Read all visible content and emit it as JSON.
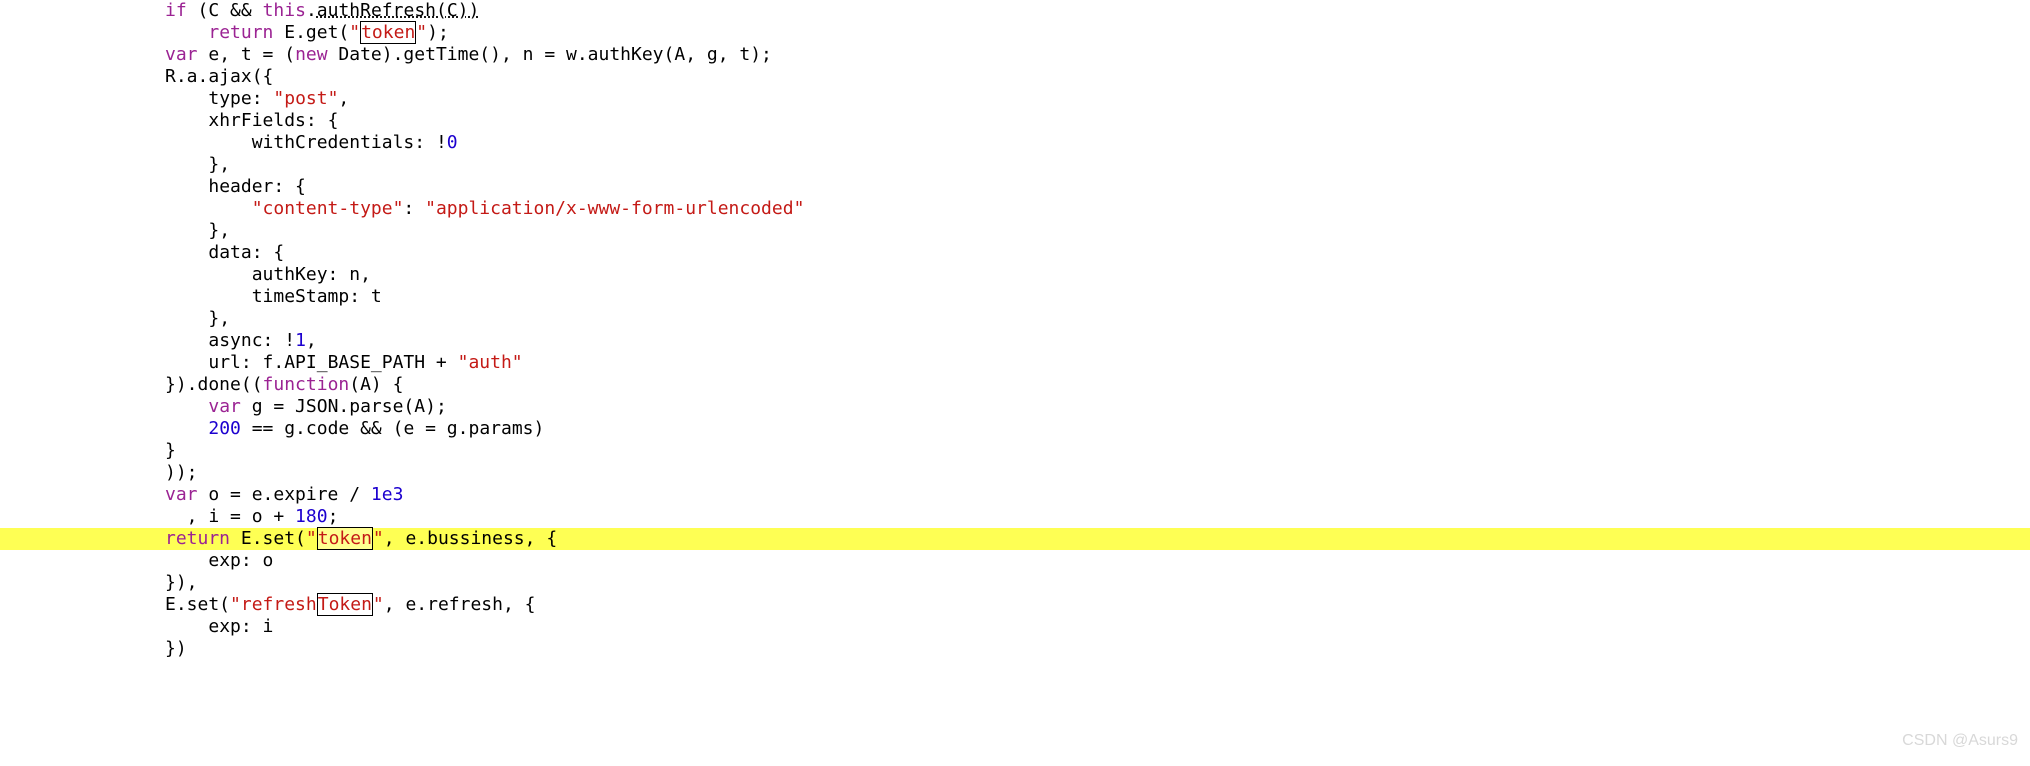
{
  "code": {
    "lines": [
      {
        "indent": 0,
        "hl": false,
        "parts": [
          {
            "c": "kw",
            "t": "if"
          },
          {
            "c": "op",
            "t": " (C "
          },
          {
            "c": "op",
            "t": "&&"
          },
          {
            "c": "op",
            "t": " "
          },
          {
            "c": "kw",
            "t": "this"
          },
          {
            "c": "op",
            "t": "."
          },
          {
            "c": "und",
            "t": "authRefresh(C))"
          }
        ]
      },
      {
        "indent": 1,
        "hl": false,
        "parts": [
          {
            "c": "kw",
            "t": "return"
          },
          {
            "c": "op",
            "t": " E.get("
          },
          {
            "c": "str",
            "t": "\""
          },
          {
            "c": "box",
            "t": "token"
          },
          {
            "c": "str",
            "t": "\""
          },
          {
            "c": "op",
            "t": ");"
          }
        ]
      },
      {
        "indent": 0,
        "hl": false,
        "parts": [
          {
            "c": "kw",
            "t": "var"
          },
          {
            "c": "op",
            "t": " e, t = ("
          },
          {
            "c": "kw",
            "t": "new"
          },
          {
            "c": "op",
            "t": " Date).getTime(), n = w.authKey(A, g, t);"
          }
        ]
      },
      {
        "indent": 0,
        "hl": false,
        "parts": [
          {
            "c": "op",
            "t": "R.a.ajax({"
          }
        ]
      },
      {
        "indent": 1,
        "hl": false,
        "parts": [
          {
            "c": "pname",
            "t": "type: "
          },
          {
            "c": "str",
            "t": "\"post\""
          },
          {
            "c": "op",
            "t": ","
          }
        ]
      },
      {
        "indent": 1,
        "hl": false,
        "parts": [
          {
            "c": "pname",
            "t": "xhrFields: {"
          }
        ]
      },
      {
        "indent": 2,
        "hl": false,
        "parts": [
          {
            "c": "pname",
            "t": "withCredentials: "
          },
          {
            "c": "op",
            "t": "!"
          },
          {
            "c": "num",
            "t": "0"
          }
        ]
      },
      {
        "indent": 1,
        "hl": false,
        "parts": [
          {
            "c": "op",
            "t": "},"
          }
        ]
      },
      {
        "indent": 1,
        "hl": false,
        "parts": [
          {
            "c": "pname",
            "t": "header: {"
          }
        ]
      },
      {
        "indent": 2,
        "hl": false,
        "parts": [
          {
            "c": "str",
            "t": "\"content-type\""
          },
          {
            "c": "op",
            "t": ": "
          },
          {
            "c": "str",
            "t": "\"application/x-www-form-urlencoded\""
          }
        ]
      },
      {
        "indent": 1,
        "hl": false,
        "parts": [
          {
            "c": "op",
            "t": "},"
          }
        ]
      },
      {
        "indent": 1,
        "hl": false,
        "parts": [
          {
            "c": "pname",
            "t": "data: {"
          }
        ]
      },
      {
        "indent": 2,
        "hl": false,
        "parts": [
          {
            "c": "pname",
            "t": "authKey: n,"
          }
        ]
      },
      {
        "indent": 2,
        "hl": false,
        "parts": [
          {
            "c": "pname",
            "t": "timeStamp: t"
          }
        ]
      },
      {
        "indent": 1,
        "hl": false,
        "parts": [
          {
            "c": "op",
            "t": "},"
          }
        ]
      },
      {
        "indent": 1,
        "hl": false,
        "parts": [
          {
            "c": "pname",
            "t": "async: "
          },
          {
            "c": "op",
            "t": "!"
          },
          {
            "c": "num",
            "t": "1"
          },
          {
            "c": "op",
            "t": ","
          }
        ]
      },
      {
        "indent": 1,
        "hl": false,
        "parts": [
          {
            "c": "pname",
            "t": "url: f.API_BASE_PATH + "
          },
          {
            "c": "str",
            "t": "\"auth\""
          }
        ]
      },
      {
        "indent": 0,
        "hl": false,
        "parts": [
          {
            "c": "op",
            "t": "}).done(("
          },
          {
            "c": "kw",
            "t": "function"
          },
          {
            "c": "op",
            "t": "(A) {"
          }
        ]
      },
      {
        "indent": 1,
        "hl": false,
        "parts": [
          {
            "c": "kw",
            "t": "var"
          },
          {
            "c": "op",
            "t": " g = JSON.parse(A);"
          }
        ]
      },
      {
        "indent": 1,
        "hl": false,
        "parts": [
          {
            "c": "num",
            "t": "200"
          },
          {
            "c": "op",
            "t": " == g.code "
          },
          {
            "c": "op",
            "t": "&&"
          },
          {
            "c": "op",
            "t": " (e = g.params)"
          }
        ]
      },
      {
        "indent": 0,
        "hl": false,
        "parts": [
          {
            "c": "op",
            "t": "}"
          }
        ]
      },
      {
        "indent": 0,
        "hl": false,
        "parts": [
          {
            "c": "op",
            "t": "));"
          }
        ]
      },
      {
        "indent": 0,
        "hl": false,
        "parts": [
          {
            "c": "kw",
            "t": "var"
          },
          {
            "c": "op",
            "t": " o = e.expire / "
          },
          {
            "c": "num",
            "t": "1e3"
          }
        ]
      },
      {
        "indent": 0,
        "hl": false,
        "parts": [
          {
            "c": "op",
            "t": "  , i = o + "
          },
          {
            "c": "num",
            "t": "180"
          },
          {
            "c": "op",
            "t": ";"
          }
        ]
      },
      {
        "indent": 0,
        "hl": true,
        "parts": [
          {
            "c": "kw",
            "t": "return"
          },
          {
            "c": "op",
            "t": " E.set("
          },
          {
            "c": "str",
            "t": "\""
          },
          {
            "c": "box-hl",
            "t": "token"
          },
          {
            "c": "str",
            "t": "\""
          },
          {
            "c": "op",
            "t": ", e.bussiness, {"
          }
        ]
      },
      {
        "indent": 1,
        "hl": false,
        "parts": [
          {
            "c": "pname",
            "t": "exp: o"
          }
        ]
      },
      {
        "indent": 0,
        "hl": false,
        "parts": [
          {
            "c": "op",
            "t": "}),"
          }
        ]
      },
      {
        "indent": 0,
        "hl": false,
        "parts": [
          {
            "c": "op",
            "t": "E.set("
          },
          {
            "c": "str",
            "t": "\"refresh"
          },
          {
            "c": "box",
            "t": "Token"
          },
          {
            "c": "str",
            "t": "\""
          },
          {
            "c": "op",
            "t": ", e.refresh, {"
          }
        ]
      },
      {
        "indent": 1,
        "hl": false,
        "parts": [
          {
            "c": "pname",
            "t": "exp: i"
          }
        ]
      },
      {
        "indent": 0,
        "hl": false,
        "parts": [
          {
            "c": "op",
            "t": "})"
          }
        ]
      }
    ]
  },
  "watermark": "CSDN @Asurs9"
}
